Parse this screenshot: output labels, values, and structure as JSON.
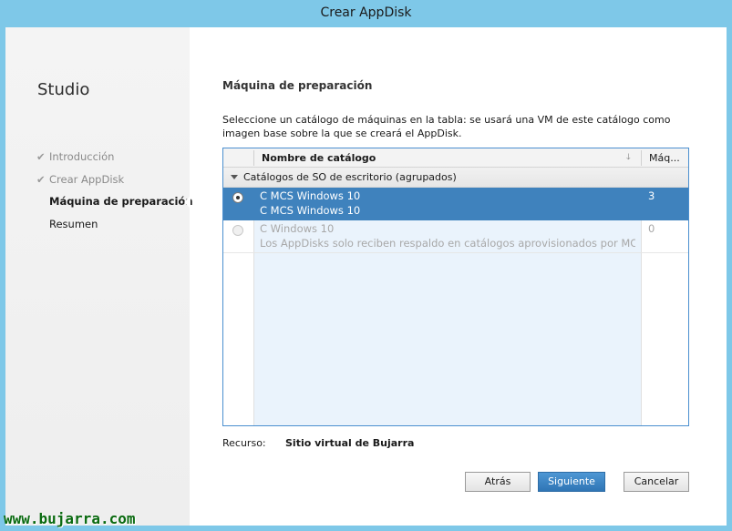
{
  "window": {
    "title": "Crear AppDisk"
  },
  "sidebar": {
    "title": "Studio",
    "steps": [
      {
        "label": "Introducción",
        "state": "done"
      },
      {
        "label": "Crear AppDisk",
        "state": "done"
      },
      {
        "label": "Máquina de preparación",
        "state": "active"
      },
      {
        "label": "Resumen",
        "state": "pending"
      }
    ],
    "check_glyph": "✔"
  },
  "main": {
    "heading": "Máquina de preparación",
    "description": "Seleccione un catálogo de máquinas en la tabla: se usará una VM de este catálogo como imagen base sobre la que se creará el AppDisk.",
    "table": {
      "columns": [
        "Nombre de catálogo",
        "Máq..."
      ],
      "sort_icon": "sort-descending-icon",
      "group": "Catálogos de SO de escritorio (agrupados)",
      "rows": [
        {
          "name": "C MCS Windows 10",
          "detail": "C MCS Windows 10",
          "count": "3",
          "selected": true,
          "enabled": true
        },
        {
          "name": "C Windows 10",
          "detail": "Los AppDisks solo reciben respaldo en catálogos aprovisionados por MCS y...",
          "count": "0",
          "selected": false,
          "enabled": false
        }
      ]
    },
    "resource_label": "Recurso:",
    "resource_value": "Sitio virtual de Bujarra"
  },
  "buttons": {
    "back": "Atrás",
    "next": "Siguiente",
    "cancel": "Cancelar"
  },
  "watermark": "www.bujarra.com",
  "colors": {
    "selection": "#3f82bd",
    "titlebar": "#7ec8e8",
    "watermark": "#0a6a10"
  }
}
